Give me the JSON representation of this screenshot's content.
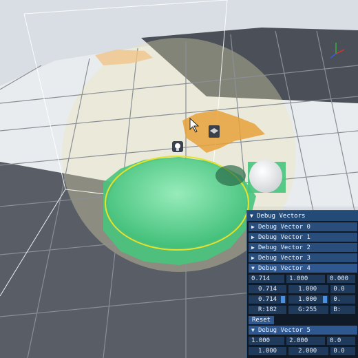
{
  "panel": {
    "title": "Debug Vectors",
    "collapsed_rows": [
      {
        "label": "Debug Vector 0",
        "state": "collapsed"
      },
      {
        "label": "Debug Vector 1",
        "state": "collapsed"
      },
      {
        "label": "Debug Vector 2",
        "state": "collapsed"
      },
      {
        "label": "Debug Vector 3",
        "state": "collapsed"
      }
    ],
    "vector4": {
      "label": "Debug Vector 4",
      "row1": [
        "0.714",
        "1.000",
        "0.000"
      ],
      "row2": [
        "0.714",
        "1.000",
        "0.0"
      ],
      "row3": [
        "0.714",
        "1.000",
        "0."
      ],
      "rgb": [
        "R:182",
        "G:255",
        "B:"
      ],
      "reset_label": "Reset"
    },
    "vector5": {
      "label": "Debug Vector 5",
      "row1": [
        "1.000",
        "2.000",
        "0.0"
      ],
      "row2": [
        "1.000",
        "2.000",
        "0.0"
      ]
    },
    "arrow_collapsed": "▶",
    "arrow_expanded": "▼"
  },
  "colors": {
    "floor_light": "#eef1f4",
    "floor_dark": "#4a4f58",
    "selection_orange": "#e8a23a",
    "green_region": "#48c47c",
    "yellow_ring": "#e6e22a",
    "panel_bg": "#0f1a26",
    "panel_header": "#244a78"
  },
  "icons": [
    "cursor-icon",
    "camera-gizmo-icon",
    "lightbulb-icon",
    "axis-gizmo-icon"
  ]
}
